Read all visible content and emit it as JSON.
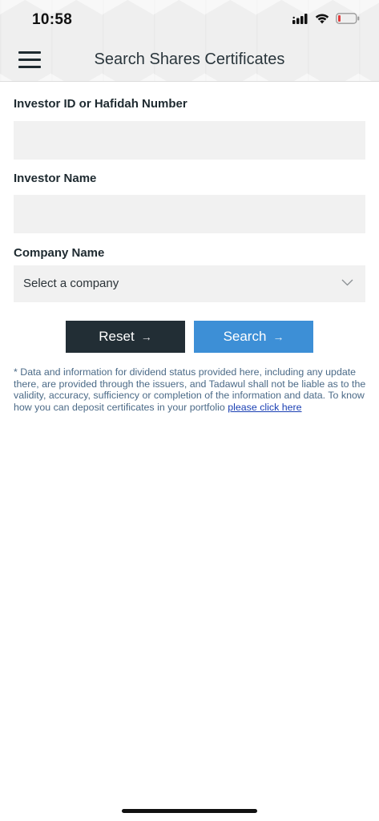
{
  "status_bar": {
    "time": "10:58",
    "icons": [
      "signal-icon",
      "wifi-icon",
      "battery-icon"
    ]
  },
  "header": {
    "menu_icon": "hamburger-menu-icon",
    "title": "Search Shares Certificates"
  },
  "form": {
    "investor_id": {
      "label": "Investor ID or Hafidah Number",
      "value": "",
      "placeholder": ""
    },
    "investor_name": {
      "label": "Investor Name",
      "value": "",
      "placeholder": ""
    },
    "company": {
      "label": "Company Name",
      "selected": "Select a company",
      "icon": "chevron-down-icon"
    }
  },
  "buttons": {
    "reset_label": "Reset",
    "search_label": "Search",
    "arrow": "→"
  },
  "disclaimer": {
    "text": "* Data and information for dividend status provided here, including any update there, are provided through the issuers, and Tadawul shall not be liable as to the validity, accuracy, sufficiency or completion of the information and data. To know how you can deposit certificates in your portfolio ",
    "link_text": "please click here"
  },
  "colors": {
    "reset_button": "#222e35",
    "search_button": "#3d8fd6",
    "input_bg": "#f1f1f1",
    "disclaimer_text": "#4b6a87",
    "link": "#1a3fb3"
  }
}
